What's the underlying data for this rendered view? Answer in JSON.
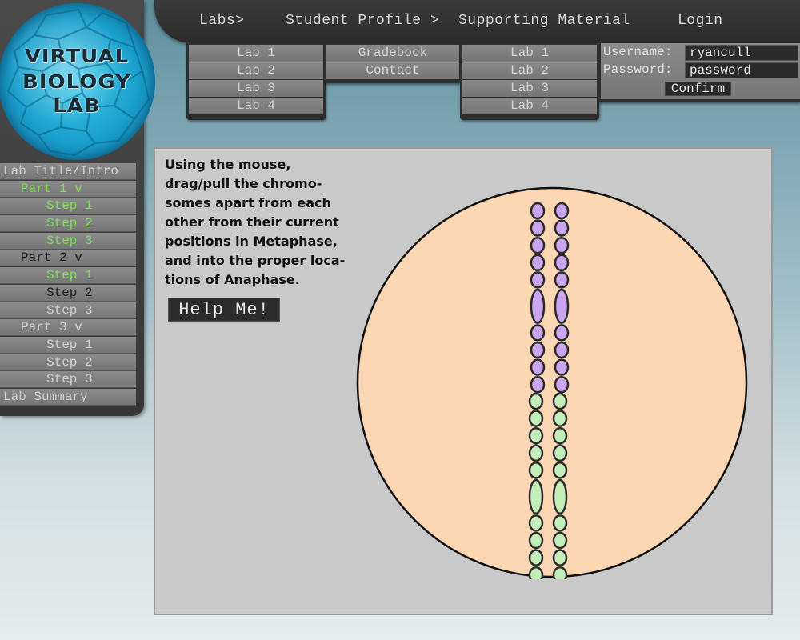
{
  "logo": {
    "lines": [
      "VIRTUAL",
      "BIOLOGY",
      "LAB"
    ]
  },
  "nav": {
    "labs": "Labs>",
    "profile": "Student Profile >",
    "supporting": "Supporting Material",
    "login": "Login"
  },
  "labs_menu": [
    "Lab 1",
    "Lab 2",
    "Lab 3",
    "Lab 4"
  ],
  "profile_menu": [
    "Gradebook",
    "Contact"
  ],
  "supporting_menu": [
    "Lab 1",
    "Lab 2",
    "Lab 3",
    "Lab 4"
  ],
  "login": {
    "username_label": "Username:",
    "username_value": "ryancull",
    "password_label": "Password:",
    "password_value": "password",
    "confirm": "Confirm"
  },
  "sidebar": [
    {
      "label": "Lab Title/Intro",
      "level": 0,
      "color": "#d0d0d0"
    },
    {
      "label": "Part 1 v",
      "level": 1,
      "color": "#7ee05a"
    },
    {
      "label": "Step 1",
      "level": 2,
      "color": "#7ee05a"
    },
    {
      "label": "Step 2",
      "level": 2,
      "color": "#7ee05a"
    },
    {
      "label": "Step 3",
      "level": 2,
      "color": "#7ee05a"
    },
    {
      "label": "Part 2 v",
      "level": 1,
      "color": "#1e1e1e"
    },
    {
      "label": "Step 1",
      "level": 2,
      "color": "#7ee05a"
    },
    {
      "label": "Step 2",
      "level": 2,
      "color": "#1e1e1e"
    },
    {
      "label": "Step 3",
      "level": 2,
      "color": "#d0d0d0"
    },
    {
      "label": "Part 3 v",
      "level": 1,
      "color": "#d0d0d0"
    },
    {
      "label": "Step 1",
      "level": 2,
      "color": "#d0d0d0"
    },
    {
      "label": "Step 2",
      "level": 2,
      "color": "#d0d0d0"
    },
    {
      "label": "Step 3",
      "level": 2,
      "color": "#d0d0d0"
    },
    {
      "label": "Lab Summary",
      "level": 0,
      "color": "#d0d0d0"
    }
  ],
  "main": {
    "instruction_lines": [
      "Using the mouse,",
      "drag/pull the chromo-",
      "somes apart from each",
      "other from their current",
      "positions in Metaphase,",
      "and into the proper loca-",
      "tions of Anaphase."
    ],
    "help_button": "Help Me!"
  },
  "colors": {
    "cell_fill": "#fdd6b4",
    "chromosome_purple": "#c9a6ee",
    "chromosome_green": "#c4eeb8",
    "active_green": "#7ee05a"
  }
}
